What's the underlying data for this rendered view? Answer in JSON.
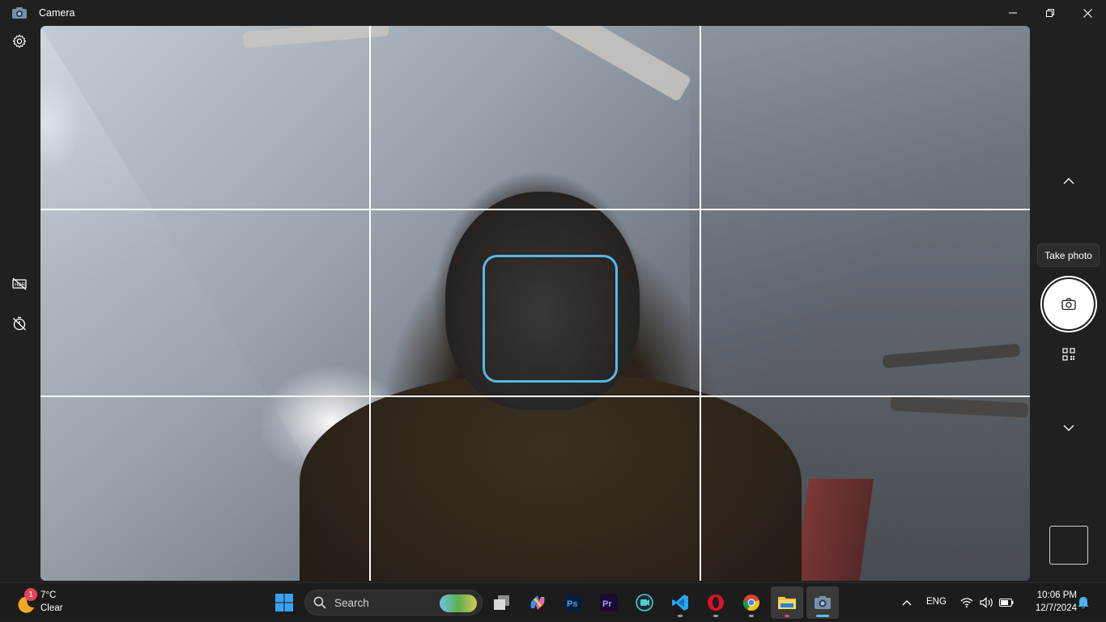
{
  "window": {
    "title": "Camera"
  },
  "camera": {
    "tooltip": "Take photo",
    "grid_lines": 2
  },
  "taskbar": {
    "weather": {
      "badge": "1",
      "temperature": "7°C",
      "condition": "Clear"
    },
    "search_label": "Search",
    "pinned_apps": [
      "task-view",
      "copilot",
      "photoshop",
      "premiere-pro",
      "screen-recorder",
      "vscode",
      "opera",
      "chrome",
      "file-explorer",
      "camera"
    ],
    "tray": {
      "language": "ENG",
      "time": "10:06 PM",
      "date": "12/7/2024"
    }
  },
  "colors": {
    "accent": "#5cc0f0",
    "face_box": "#58b8e8",
    "background": "#202020"
  }
}
